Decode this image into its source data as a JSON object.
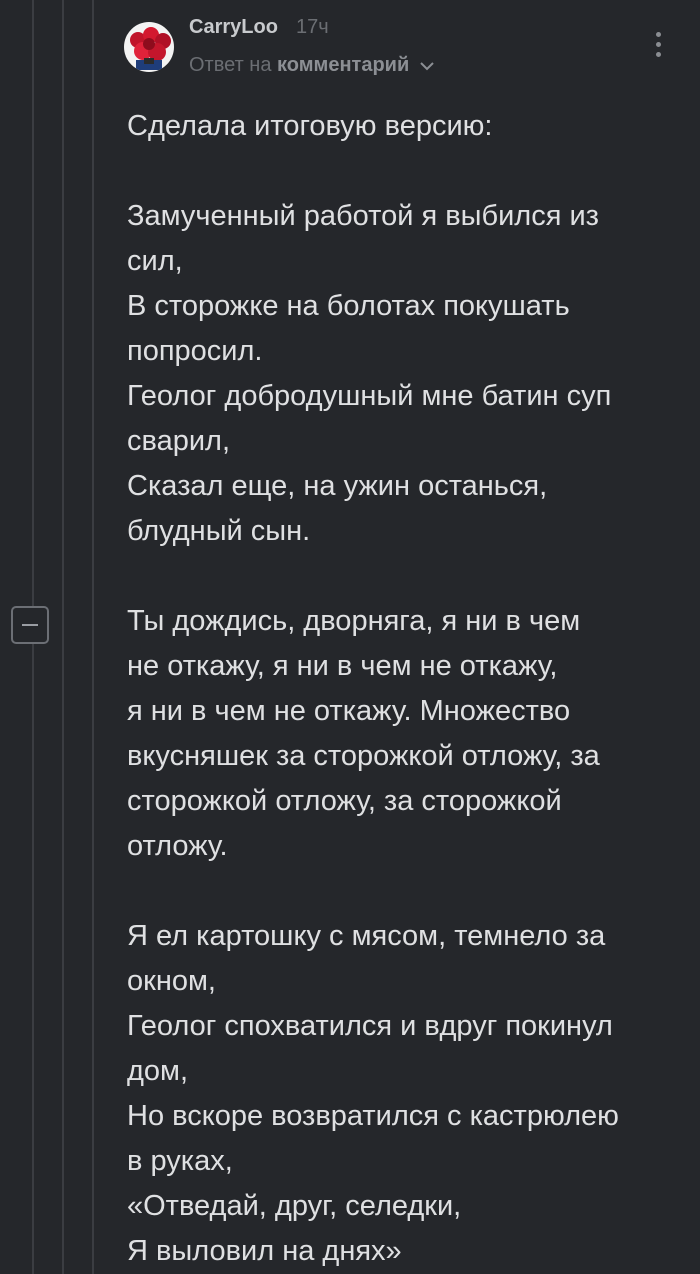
{
  "comment": {
    "author": "CarryLoo",
    "time_ago": "17ч",
    "reply_prefix": "Ответ на",
    "reply_link": "комментарий",
    "paragraphs": [
      "Сделала итоговую версию:",
      "Замученный работой я выбился из\nсил,\nВ сторожке на болотах покушать\nпопросил.\nГеолог добродушный мне батин суп\nсварил,\nСказал еще, на ужин останься,\nблудный сын.",
      "Ты дождись, дворняга, я ни в чем\nне откажу, я ни в чем не откажу,\nя ни в чем не откажу. Множество\nвкусняшек за сторожкой отложу, за\nсторожкой отложу, за сторожкой\nотложу.",
      "Я ел картошку с мясом, темнело за\nокном,\nГеолог спохватился и вдруг покинул\nдом,\nНо вскоре возвратился с кастрюлею\nв руках,\n«Отведай, друг, селедки,\nЯ выловил на днях»"
    ]
  },
  "icons": {
    "avatar": "avatar-image",
    "more": "more-vertical-icon",
    "chevron": "chevron-down-icon",
    "collapse": "collapse-minus-icon"
  },
  "colors": {
    "background": "#25272b",
    "text": "#dfe0e2",
    "muted": "#6b6e73",
    "thread_line": "#3b3d42"
  }
}
